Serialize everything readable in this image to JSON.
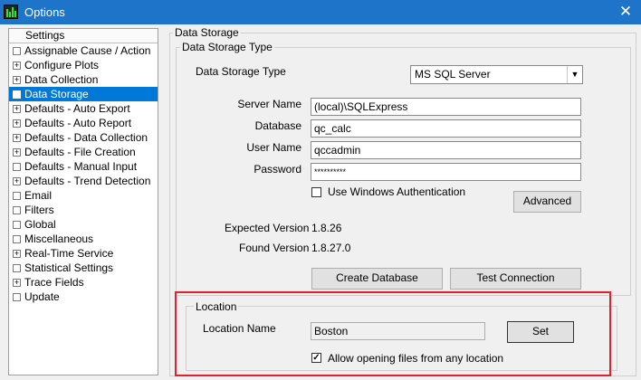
{
  "window": {
    "title": "Options",
    "close_glyph": "✕"
  },
  "tree": {
    "header": "Settings",
    "items": [
      {
        "label": "Assignable Cause / Action",
        "expander": ""
      },
      {
        "label": "Configure Plots",
        "expander": "+"
      },
      {
        "label": "Data Collection",
        "expander": "+"
      },
      {
        "label": "Data Storage",
        "expander": "",
        "selected": true
      },
      {
        "label": "Defaults - Auto Export",
        "expander": "+"
      },
      {
        "label": "Defaults - Auto Report",
        "expander": "+"
      },
      {
        "label": "Defaults - Data Collection",
        "expander": "+"
      },
      {
        "label": "Defaults - File Creation",
        "expander": "+"
      },
      {
        "label": "Defaults - Manual Input",
        "expander": ""
      },
      {
        "label": "Defaults - Trend Detection",
        "expander": "+"
      },
      {
        "label": "Email",
        "expander": ""
      },
      {
        "label": "Filters",
        "expander": ""
      },
      {
        "label": "Global",
        "expander": ""
      },
      {
        "label": "Miscellaneous",
        "expander": ""
      },
      {
        "label": "Real-Time Service",
        "expander": "+"
      },
      {
        "label": "Statistical Settings",
        "expander": ""
      },
      {
        "label": "Trace Fields",
        "expander": "+"
      },
      {
        "label": "Update",
        "expander": ""
      }
    ]
  },
  "data_storage": {
    "group_title": "Data Storage",
    "type_group_title": "Data Storage Type",
    "type_label": "Data Storage Type",
    "type_value": "MS SQL Server",
    "server_name_label": "Server Name",
    "server_name_value": "(local)\\SQLExpress",
    "database_label": "Database",
    "database_value": "qc_calc",
    "user_name_label": "User Name",
    "user_name_value": "qccadmin",
    "password_label": "Password",
    "password_value": "**********",
    "windows_auth_label": "Use Windows Authentication",
    "windows_auth_checked": false,
    "advanced_button": "Advanced",
    "expected_version_label": "Expected Version",
    "expected_version_value": "1.8.26",
    "found_version_label": "Found Version",
    "found_version_value": "1.8.27.0",
    "create_database_button": "Create Database",
    "test_connection_button": "Test Connection"
  },
  "location": {
    "group_title": "Location",
    "name_label": "Location Name",
    "name_value": "Boston",
    "set_button": "Set",
    "allow_any_label": "Allow opening files from any location",
    "allow_any_checked": true,
    "check_glyph": "✓"
  },
  "colors": {
    "titlebar": "#1e74c8",
    "selection": "#0078d7",
    "highlight_box": "#e0222c"
  }
}
